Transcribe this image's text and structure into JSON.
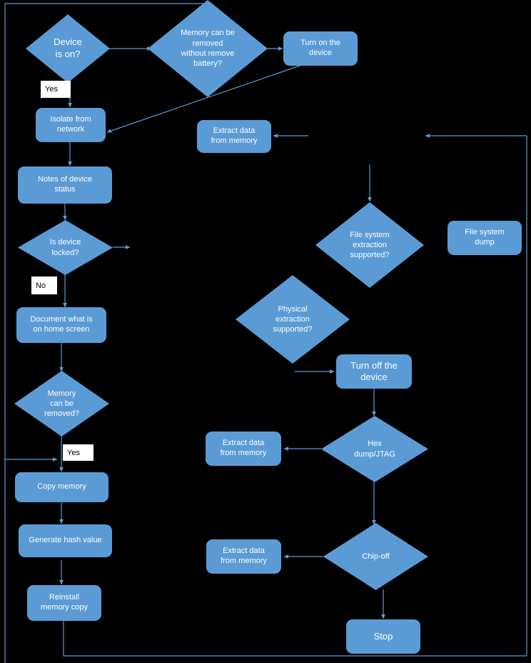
{
  "diagram": {
    "title": "Mobile device forensic acquisition flowchart",
    "colors": {
      "shape_fill": "#5b9bd5",
      "connector": "#5b9bd5",
      "text": "#ffffff",
      "label_bg": "#ffffff",
      "label_text": "#000000",
      "background": "#000000"
    },
    "nodes": [
      {
        "id": "device_on",
        "shape": "decision",
        "text": "Device\nis on?"
      },
      {
        "id": "mem_no_battery",
        "shape": "decision",
        "text": "Memory can be\nremoved\nwithout remove\nbattery?"
      },
      {
        "id": "turn_on",
        "shape": "process",
        "text": "Turn on the\ndevice"
      },
      {
        "id": "isolate",
        "shape": "process",
        "text": "Isolate from\nnetwork"
      },
      {
        "id": "extract_top",
        "shape": "process",
        "text": "Extract data\nfrom memory"
      },
      {
        "id": "notes_status",
        "shape": "process",
        "text": "Notes of device\nstatus"
      },
      {
        "id": "device_locked",
        "shape": "decision",
        "text": "Is device\nlocked?"
      },
      {
        "id": "fs_extraction",
        "shape": "decision",
        "text": "File system\nextraction\nsupported?"
      },
      {
        "id": "fs_dump",
        "shape": "process",
        "text": "File system\ndump"
      },
      {
        "id": "document_home",
        "shape": "process",
        "text": "Document what is\non home screen"
      },
      {
        "id": "physical_extraction",
        "shape": "decision",
        "text": "Physical\nextraction\nsupported?"
      },
      {
        "id": "turn_off",
        "shape": "process",
        "text": "Turn off the\ndevice"
      },
      {
        "id": "memory_removed",
        "shape": "decision",
        "text": "Memory\ncan be\nremoved?"
      },
      {
        "id": "extract_hex",
        "shape": "process",
        "text": "Extract data\nfrom memory"
      },
      {
        "id": "hex_dump",
        "shape": "decision",
        "text": "Hex\ndump/JTAG"
      },
      {
        "id": "copy_memory",
        "shape": "process",
        "text": "Copy memory"
      },
      {
        "id": "generate_hash",
        "shape": "process",
        "text": "Generate hash value"
      },
      {
        "id": "extract_chipoff",
        "shape": "process",
        "text": "Extract data\nfrom memory"
      },
      {
        "id": "chip_off",
        "shape": "decision",
        "text": "Chip-off"
      },
      {
        "id": "reinstall_copy",
        "shape": "process",
        "text": "Reinstall\nmemory copy"
      },
      {
        "id": "stop",
        "shape": "process",
        "text": "Stop"
      }
    ],
    "edge_labels": [
      {
        "id": "yes_device_on",
        "text": "Yes"
      },
      {
        "id": "no_device_locked",
        "text": "No"
      },
      {
        "id": "yes_memory_removed",
        "text": "Yes"
      }
    ]
  }
}
